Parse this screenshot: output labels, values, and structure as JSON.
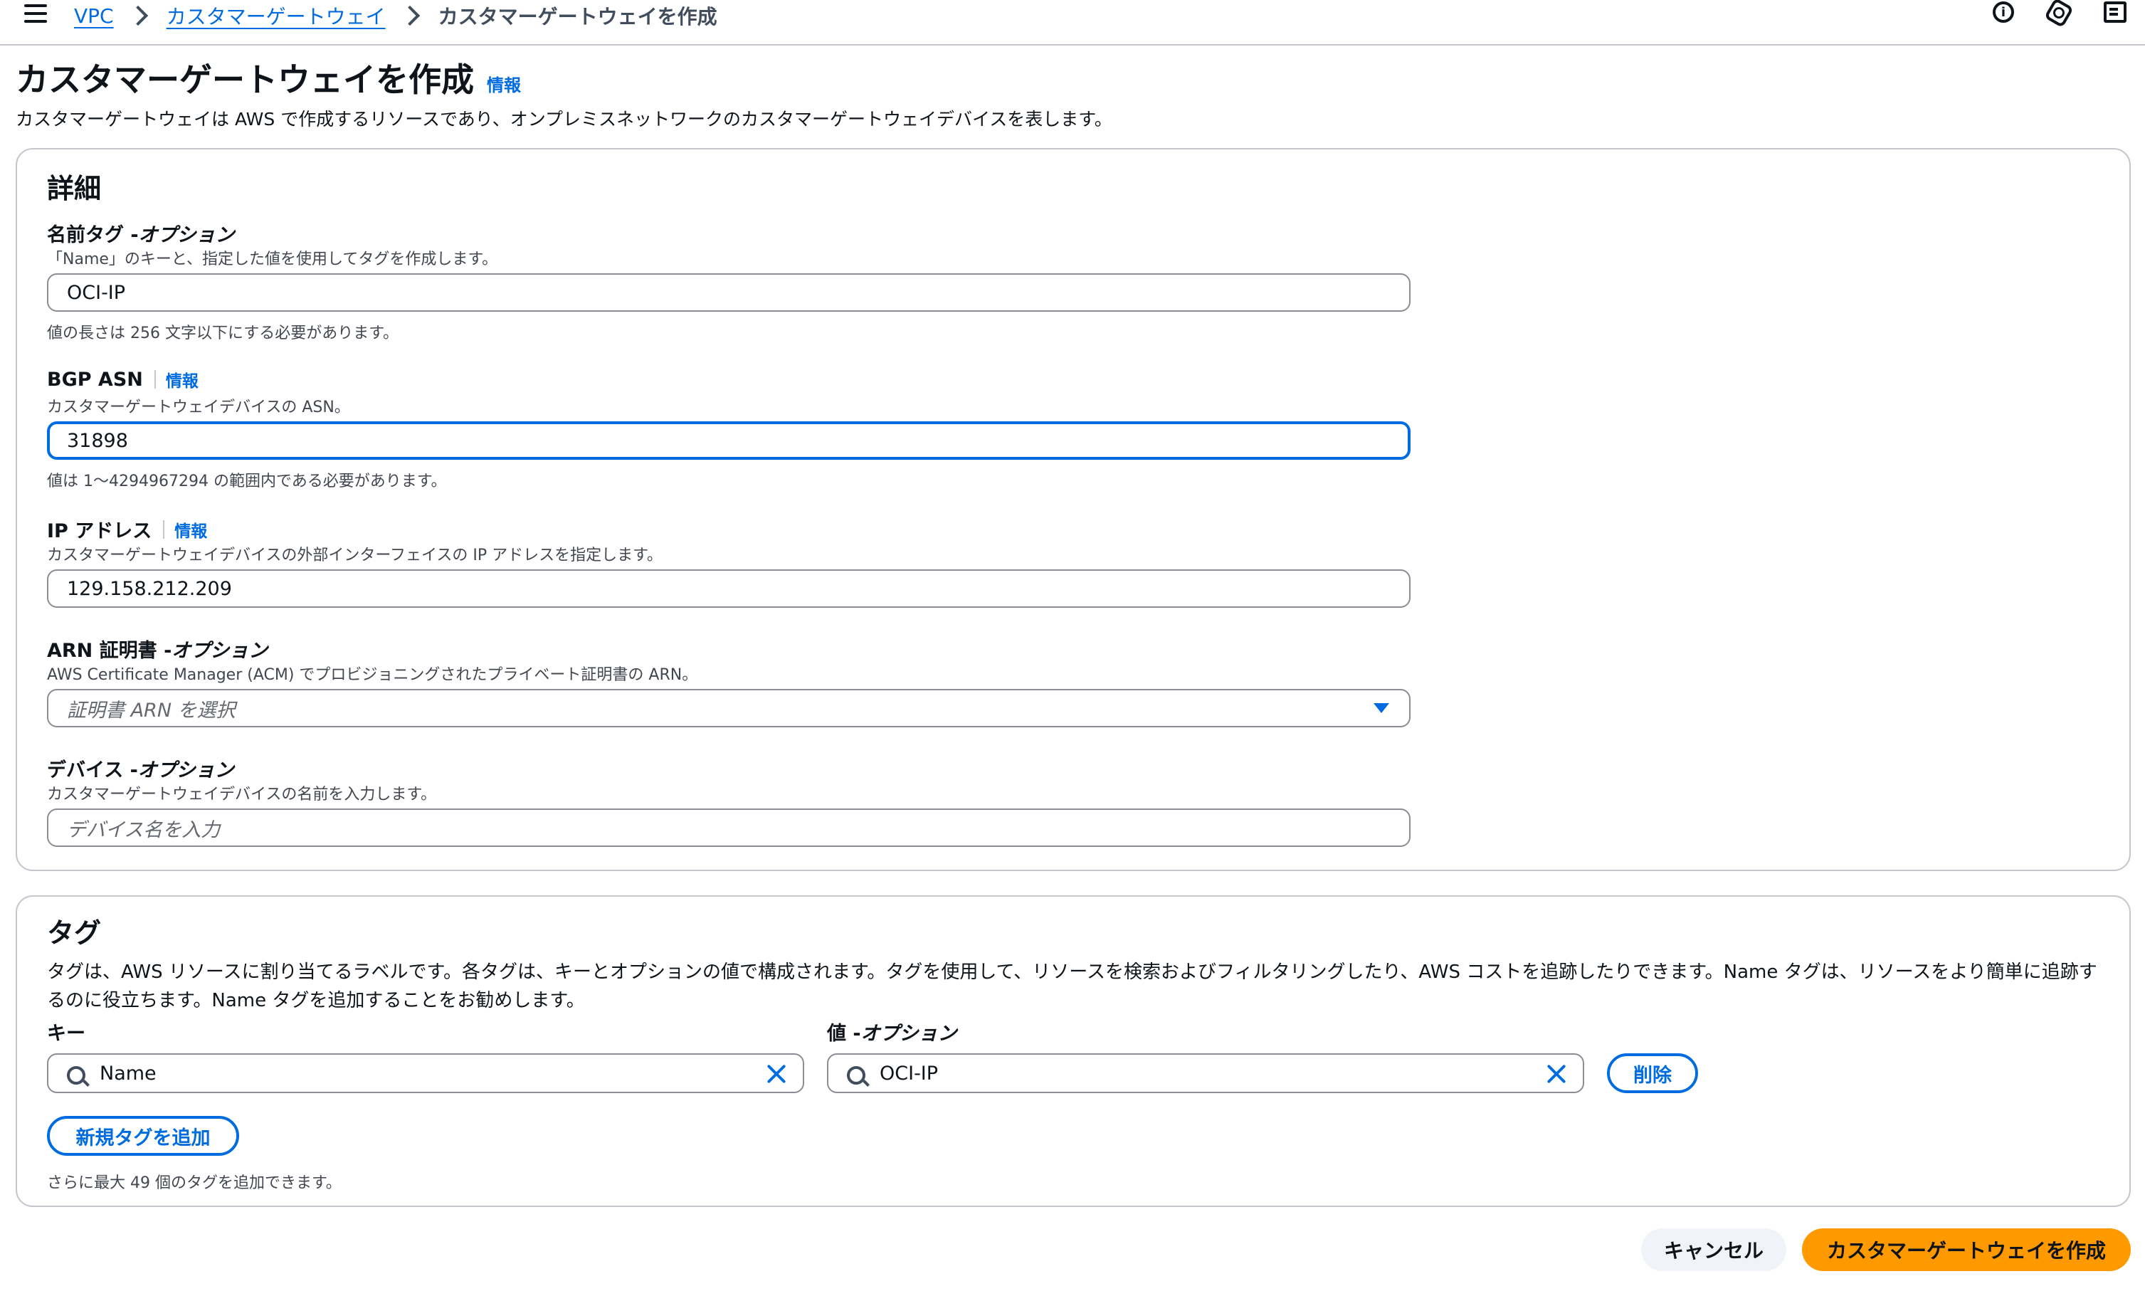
{
  "breadcrumb": {
    "vpc": "VPC",
    "customer_gateways": "カスタマーゲートウェイ",
    "current": "カスタマーゲートウェイを作成"
  },
  "header": {
    "title": "カスタマーゲートウェイを作成",
    "info": "情報",
    "description": "カスタマーゲートウェイは AWS で作成するリソースであり、オンプレミスネットワークのカスタマーゲートウェイデバイスを表します。"
  },
  "details": {
    "title": "詳細",
    "name_tag": {
      "label_main": "名前タグ - ",
      "label_opt": "オプション",
      "description": "「Name」のキーと、指定した値を使用してタグを作成します。",
      "value": "OCI-IP",
      "constraint": "値の長さは 256 文字以下にする必要があります。"
    },
    "bgp_asn": {
      "label": "BGP ASN",
      "info": "情報",
      "description": "カスタマーゲートウェイデバイスの ASN。",
      "value": "31898",
      "constraint": "値は 1～4294967294 の範囲内である必要があります。"
    },
    "ip_address": {
      "label": "IP アドレス",
      "info": "情報",
      "description": "カスタマーゲートウェイデバイスの外部インターフェイスの IP アドレスを指定します。",
      "value": "129.158.212.209"
    },
    "certificate": {
      "label_main": "ARN 証明書 - ",
      "label_opt": "オプション",
      "description": "AWS Certificate Manager (ACM) でプロビジョニングされたプライベート証明書の ARN。",
      "placeholder": "証明書 ARN を選択"
    },
    "device": {
      "label_main": "デバイス - ",
      "label_opt": "オプション",
      "description": "カスタマーゲートウェイデバイスの名前を入力します。",
      "placeholder": "デバイス名を入力"
    }
  },
  "tags": {
    "title": "タグ",
    "description": "タグは、AWS リソースに割り当てるラベルです。各タグは、キーとオプションの値で構成されます。タグを使用して、リソースを検索およびフィルタリングしたり、AWS コストを追跡したりできます。Name タグは、リソースをより簡単に追跡するのに役立ちます。Name タグを追加することをお勧めします。",
    "key_label": "キー",
    "value_label_main": "値 - ",
    "value_label_opt": "オプション",
    "key_value": "Name",
    "value_value": "OCI-IP",
    "remove": "削除",
    "add_tag": "新規タグを追加",
    "limit_note": "さらに最大 49 個のタグを追加できます。"
  },
  "footer": {
    "cancel": "キャンセル",
    "create": "カスタマーゲートウェイを作成"
  }
}
